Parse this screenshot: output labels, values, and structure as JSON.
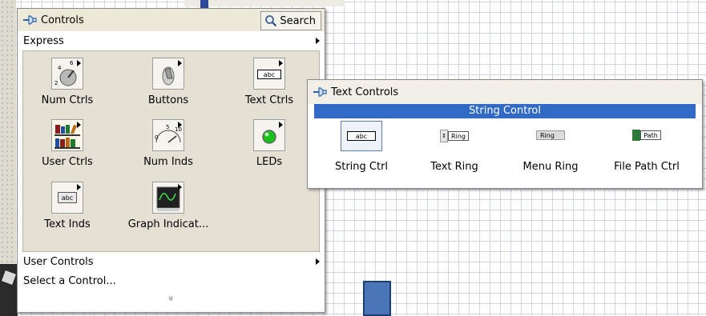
{
  "controls_palette": {
    "title": "Controls",
    "search_label": "Search",
    "express_label": "Express",
    "express_items": [
      {
        "label": "Num Ctrls",
        "icon": "numeric-knob-icon"
      },
      {
        "label": "Buttons",
        "icon": "toggle-switch-icon"
      },
      {
        "label": "Text Ctrls",
        "icon": "text-control-icon"
      },
      {
        "label": "User Ctrls",
        "icon": "books-icon"
      },
      {
        "label": "Num Inds",
        "icon": "gauge-icon"
      },
      {
        "label": "LEDs",
        "icon": "led-icon"
      },
      {
        "label": "Text Inds",
        "icon": "text-indicator-icon"
      },
      {
        "label": "Graph Indicat...",
        "icon": "graph-icon"
      }
    ],
    "user_controls_label": "User Controls",
    "select_control_label": "Select a Control...",
    "more_chevron": "»"
  },
  "text_controls_palette": {
    "title": "Text Controls",
    "selected_label": "String Control",
    "items": [
      {
        "label": "String Ctrl",
        "icon_text": "abc"
      },
      {
        "label": "Text Ring",
        "icon_text": "Ring"
      },
      {
        "label": "Menu Ring",
        "icon_text": "Ring"
      },
      {
        "label": "File Path Ctrl",
        "icon_text": "Path"
      }
    ]
  },
  "tile_icon_text": {
    "text_ctrl": "abc",
    "text_ind": "abc",
    "gauge_ticks": [
      "0",
      "5",
      "10"
    ],
    "knob_ticks": [
      "2",
      "4",
      "6"
    ]
  },
  "colors": {
    "selection_blue": "#316ac5",
    "palette_bg": "#e4e1d4",
    "title_bar": "#ece9d8",
    "led_green": "#19c21a"
  }
}
